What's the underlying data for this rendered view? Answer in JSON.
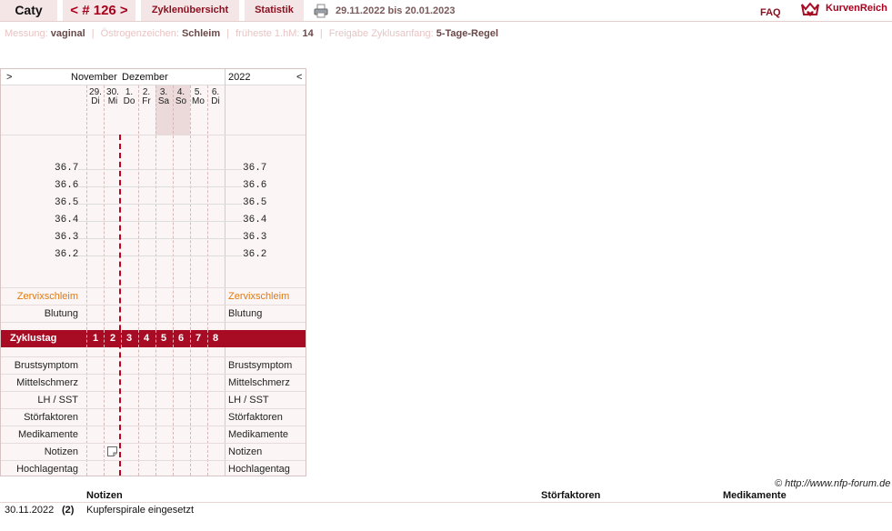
{
  "topbar": {
    "name": "Caty",
    "cycle_nav": "< # 126 >",
    "overview": "Zyklenübersicht",
    "statistics": "Statistik",
    "date_range": "29.11.2022 bis 20.01.2023",
    "faq": "FAQ",
    "logo": "KurvenReich",
    "printer_icon": "printer-icon",
    "logo_icon": "crown-heart-icon"
  },
  "settings": {
    "measurement_label": "Messung:",
    "measurement_value": "vaginal",
    "estrogen_label": "Östrogenzeichen:",
    "estrogen_value": "Schleim",
    "earliest_label": "früheste 1.hM:",
    "earliest_value": "14",
    "release_label": "Freigabe Zyklusanfang:",
    "release_value": "5-Tage-Regel",
    "separator": "|"
  },
  "chart": {
    "nav_prev": ">",
    "nav_next": "<",
    "month1": "November",
    "month2": "Dezember",
    "year": "2022",
    "days": [
      {
        "num": "29.",
        "wd": "Di"
      },
      {
        "num": "30.",
        "wd": "Mi"
      },
      {
        "num": "1.",
        "wd": "Do"
      },
      {
        "num": "2.",
        "wd": "Fr"
      },
      {
        "num": "3.",
        "wd": "Sa"
      },
      {
        "num": "4.",
        "wd": "So"
      },
      {
        "num": "5.",
        "wd": "Mo"
      },
      {
        "num": "6.",
        "wd": "Di"
      }
    ],
    "temps": [
      "36.7",
      "36.6",
      "36.5",
      "36.4",
      "36.3",
      "36.2"
    ],
    "cervix_label": "Zervixschleim",
    "bleeding_label": "Blutung",
    "cycle_day_label": "Zyklustag",
    "cycle_days": [
      "1",
      "2",
      "3",
      "4",
      "5",
      "6",
      "7",
      "8"
    ],
    "rows": [
      "Brustsymptom",
      "Mittelschmerz",
      "LH / SST",
      "Störfaktoren",
      "Medikamente",
      "Notizen",
      "Hochlagentag"
    ],
    "note_icon": "note-icon"
  },
  "footer": {
    "copyright": "© http://www.nfp-forum.de",
    "headers": {
      "notes": "Notizen",
      "disruptions": "Störfaktoren",
      "medications": "Medikamente"
    },
    "rows": [
      {
        "date": "30.11.2022",
        "day": "(2)",
        "note": "Kupferspirale eingesetzt"
      }
    ]
  },
  "colors": {
    "accent": "#a80c24",
    "tab_bg": "#f4e6e6",
    "cervix": "#e07a10"
  }
}
